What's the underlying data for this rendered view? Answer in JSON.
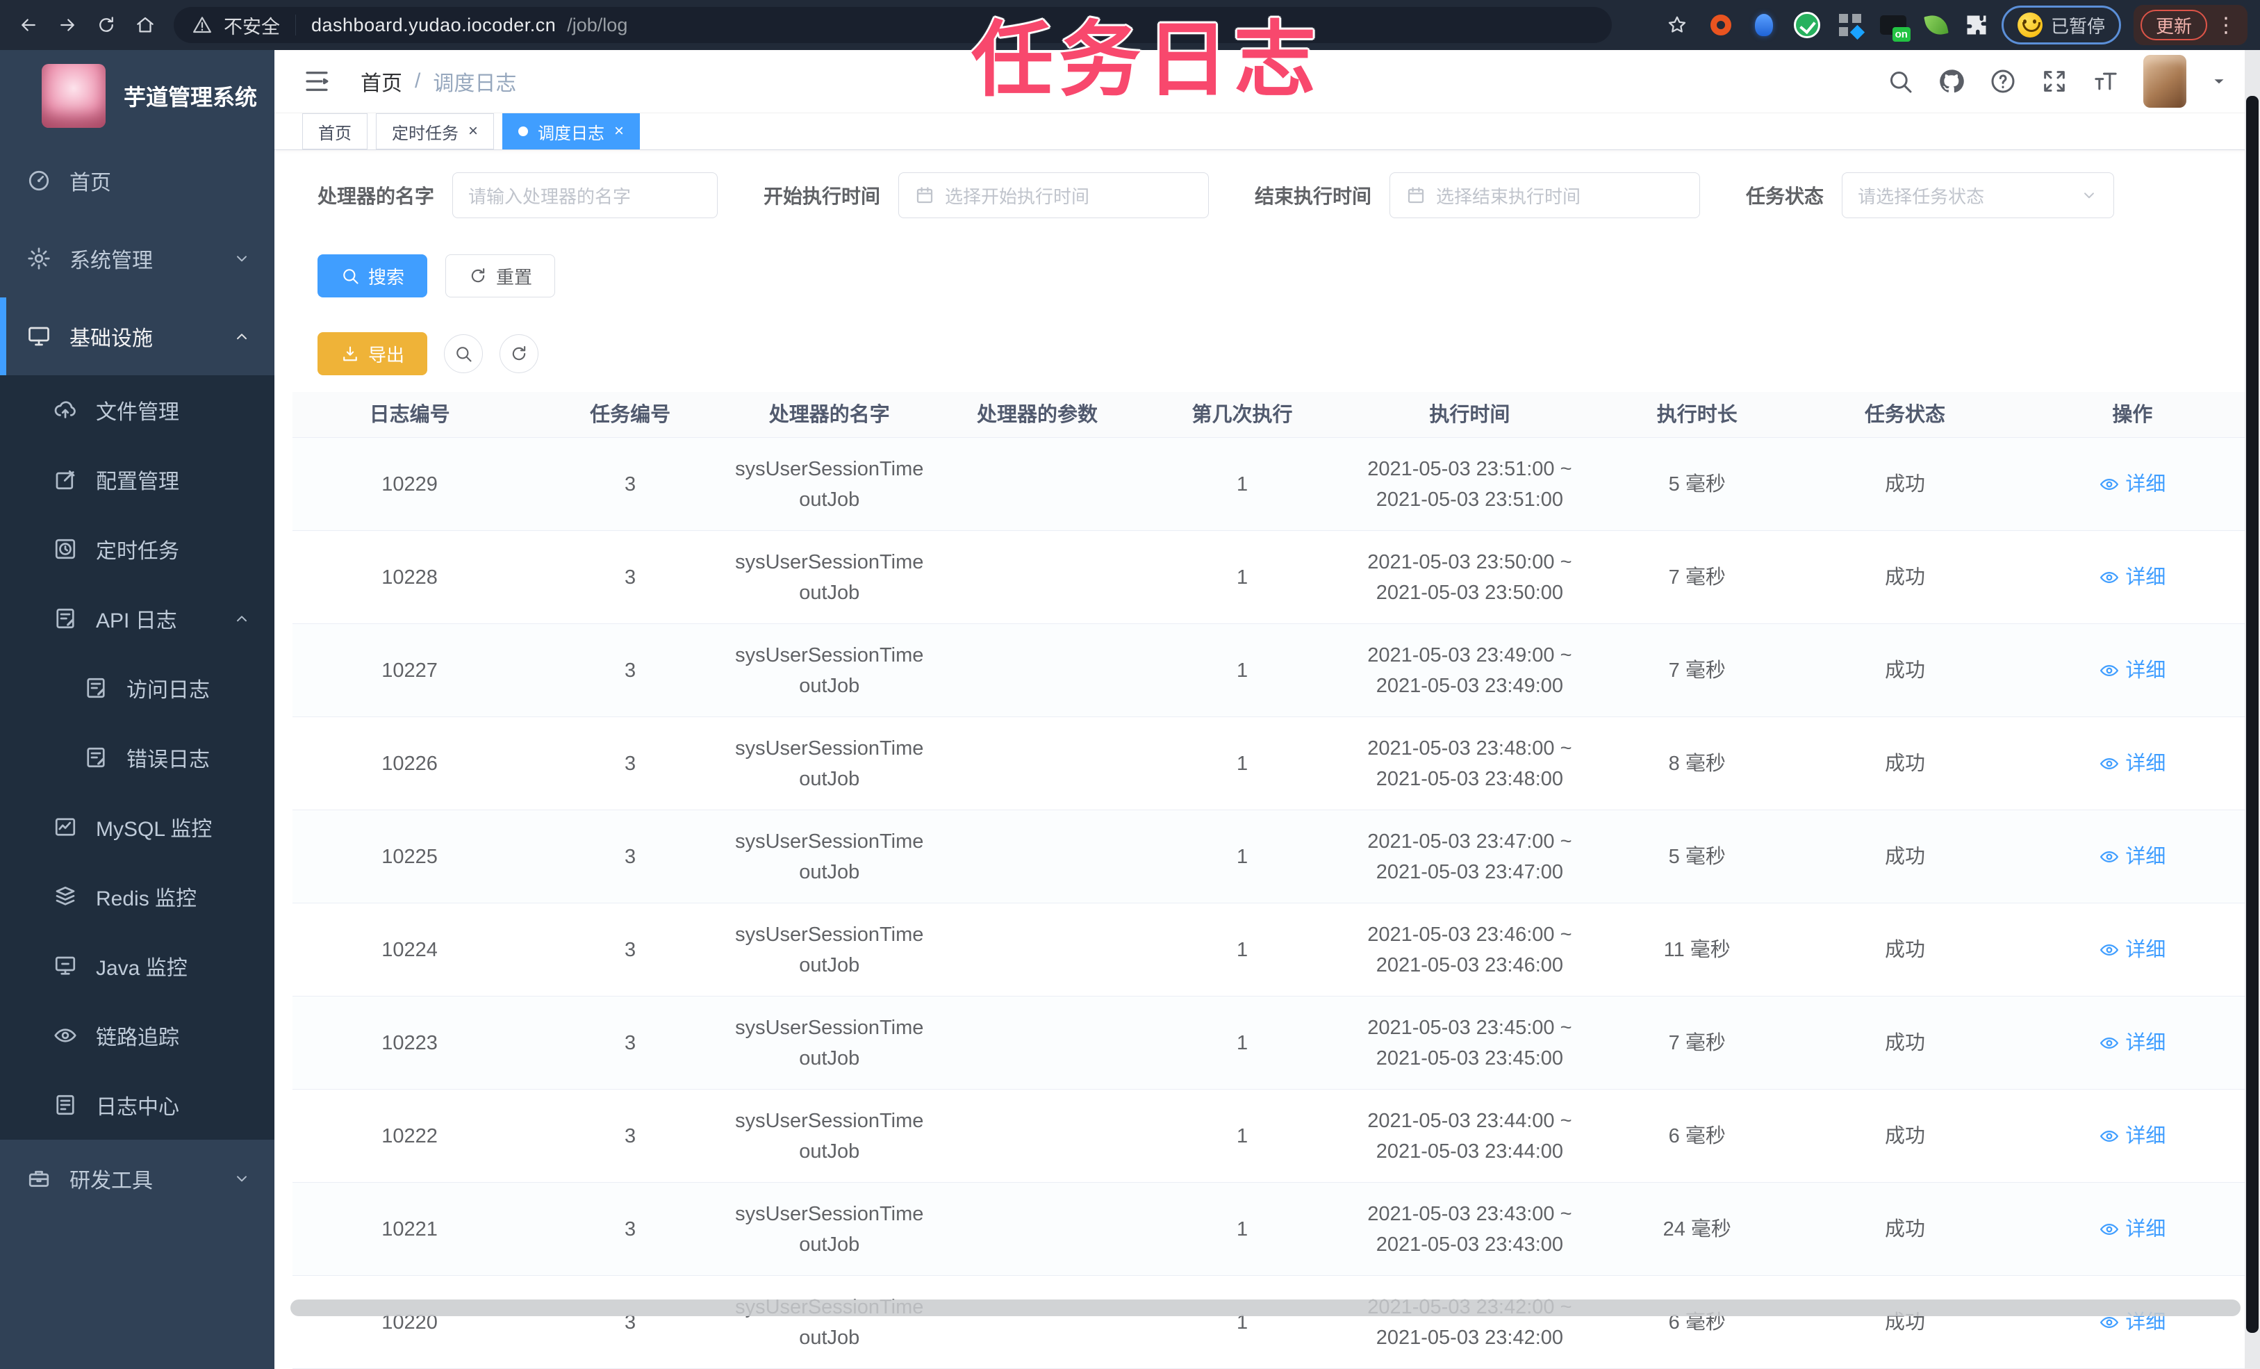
{
  "watermark": "任务日志",
  "browser": {
    "security_label": "不安全",
    "url_host": "dashboard.yudao.iocoder.cn",
    "url_path": "/job/log",
    "paused_label": "已暂停",
    "update_label": "更新"
  },
  "sidebar": {
    "app_title": "芋道管理系统",
    "menu": [
      {
        "label": "首页",
        "icon": "dashboard-icon",
        "level": 1
      },
      {
        "label": "系统管理",
        "icon": "gear-icon",
        "level": 1,
        "chevron": "chevron-down-icon"
      },
      {
        "label": "基础设施",
        "icon": "infrastructure-icon",
        "level": 1,
        "chevron": "chevron-up-icon",
        "active": true
      },
      {
        "label": "文件管理",
        "icon": "cloud-upload-icon",
        "level": 2
      },
      {
        "label": "配置管理",
        "icon": "edit-icon",
        "level": 2
      },
      {
        "label": "定时任务",
        "icon": "timer-icon",
        "level": 2
      },
      {
        "label": "API 日志",
        "icon": "api-log-icon",
        "level": 2,
        "chevron": "chevron-up-icon"
      },
      {
        "label": "访问日志",
        "icon": "access-log-icon",
        "level": 3
      },
      {
        "label": "错误日志",
        "icon": "error-log-icon",
        "level": 3
      },
      {
        "label": "MySQL 监控",
        "icon": "mysql-monitor-icon",
        "level": 2
      },
      {
        "label": "Redis 监控",
        "icon": "redis-monitor-icon",
        "level": 2
      },
      {
        "label": "Java 监控",
        "icon": "java-monitor-icon",
        "level": 2
      },
      {
        "label": "链路追踪",
        "icon": "trace-eye-icon",
        "level": 2
      },
      {
        "label": "日志中心",
        "icon": "log-center-icon",
        "level": 2
      },
      {
        "label": "研发工具",
        "icon": "toolbox-icon",
        "level": 1,
        "chevron": "chevron-down-icon"
      }
    ]
  },
  "header": {
    "breadcrumb_home": "首页",
    "breadcrumb_sep": "/",
    "breadcrumb_current": "调度日志"
  },
  "tabs": [
    {
      "label": "首页"
    },
    {
      "label": "定时任务",
      "closable": true
    },
    {
      "label": "调度日志",
      "closable": true,
      "active": true
    }
  ],
  "filters": [
    {
      "label": "处理器的名字",
      "placeholder": "请输入处理器的名字",
      "w": "a"
    },
    {
      "label": "开始执行时间",
      "placeholder": "选择开始执行时间",
      "calendar_icon": "calendar-icon",
      "w": "b"
    },
    {
      "label": "结束执行时间",
      "placeholder": "选择结束执行时间",
      "calendar_icon": "calendar-icon",
      "w": "b"
    },
    {
      "label": "任务状态",
      "placeholder": "请选择任务状态",
      "select_icon": "chevron-down-icon",
      "w": "c"
    }
  ],
  "toolbar": {
    "search_label": "搜索",
    "reset_label": "重置",
    "export_label": "导出"
  },
  "table": {
    "columns": [
      {
        "label": "日志编号"
      },
      {
        "label": "任务编号"
      },
      {
        "label": "处理器的名字"
      },
      {
        "label": "处理器的参数"
      },
      {
        "label": "第几次执行"
      },
      {
        "label": "执行时间"
      },
      {
        "label": "执行时长"
      },
      {
        "label": "任务状态"
      },
      {
        "label": "操作"
      }
    ],
    "rows": [
      {
        "log_id": "10229",
        "task_id": "3",
        "handler": "sysUserSessionTimeoutJob",
        "param": "",
        "round": "1",
        "time_from": "2021-05-03 23:51:00 ~",
        "time_to": "2021-05-03 23:51:00",
        "duration": "5 毫秒",
        "status": "成功",
        "action": "详细"
      },
      {
        "log_id": "10228",
        "task_id": "3",
        "handler": "sysUserSessionTimeoutJob",
        "param": "",
        "round": "1",
        "time_from": "2021-05-03 23:50:00 ~",
        "time_to": "2021-05-03 23:50:00",
        "duration": "7 毫秒",
        "status": "成功",
        "action": "详细"
      },
      {
        "log_id": "10227",
        "task_id": "3",
        "handler": "sysUserSessionTimeoutJob",
        "param": "",
        "round": "1",
        "time_from": "2021-05-03 23:49:00 ~",
        "time_to": "2021-05-03 23:49:00",
        "duration": "7 毫秒",
        "status": "成功",
        "action": "详细"
      },
      {
        "log_id": "10226",
        "task_id": "3",
        "handler": "sysUserSessionTimeoutJob",
        "param": "",
        "round": "1",
        "time_from": "2021-05-03 23:48:00 ~",
        "time_to": "2021-05-03 23:48:00",
        "duration": "8 毫秒",
        "status": "成功",
        "action": "详细"
      },
      {
        "log_id": "10225",
        "task_id": "3",
        "handler": "sysUserSessionTimeoutJob",
        "param": "",
        "round": "1",
        "time_from": "2021-05-03 23:47:00 ~",
        "time_to": "2021-05-03 23:47:00",
        "duration": "5 毫秒",
        "status": "成功",
        "action": "详细"
      },
      {
        "log_id": "10224",
        "task_id": "3",
        "handler": "sysUserSessionTimeoutJob",
        "param": "",
        "round": "1",
        "time_from": "2021-05-03 23:46:00 ~",
        "time_to": "2021-05-03 23:46:00",
        "duration": "11 毫秒",
        "status": "成功",
        "action": "详细"
      },
      {
        "log_id": "10223",
        "task_id": "3",
        "handler": "sysUserSessionTimeoutJob",
        "param": "",
        "round": "1",
        "time_from": "2021-05-03 23:45:00 ~",
        "time_to": "2021-05-03 23:45:00",
        "duration": "7 毫秒",
        "status": "成功",
        "action": "详细"
      },
      {
        "log_id": "10222",
        "task_id": "3",
        "handler": "sysUserSessionTimeoutJob",
        "param": "",
        "round": "1",
        "time_from": "2021-05-03 23:44:00 ~",
        "time_to": "2021-05-03 23:44:00",
        "duration": "6 毫秒",
        "status": "成功",
        "action": "详细"
      },
      {
        "log_id": "10221",
        "task_id": "3",
        "handler": "sysUserSessionTimeoutJob",
        "param": "",
        "round": "1",
        "time_from": "2021-05-03 23:43:00 ~",
        "time_to": "2021-05-03 23:43:00",
        "duration": "24 毫秒",
        "status": "成功",
        "action": "详细"
      },
      {
        "log_id": "10220",
        "task_id": "3",
        "handler": "sysUserSessionTimeoutJob",
        "param": "",
        "round": "1",
        "time_from": "2021-05-03 23:42:00 ~",
        "time_to": "2021-05-03 23:42:00",
        "duration": "6 毫秒",
        "status": "成功",
        "action": "详细"
      }
    ]
  }
}
